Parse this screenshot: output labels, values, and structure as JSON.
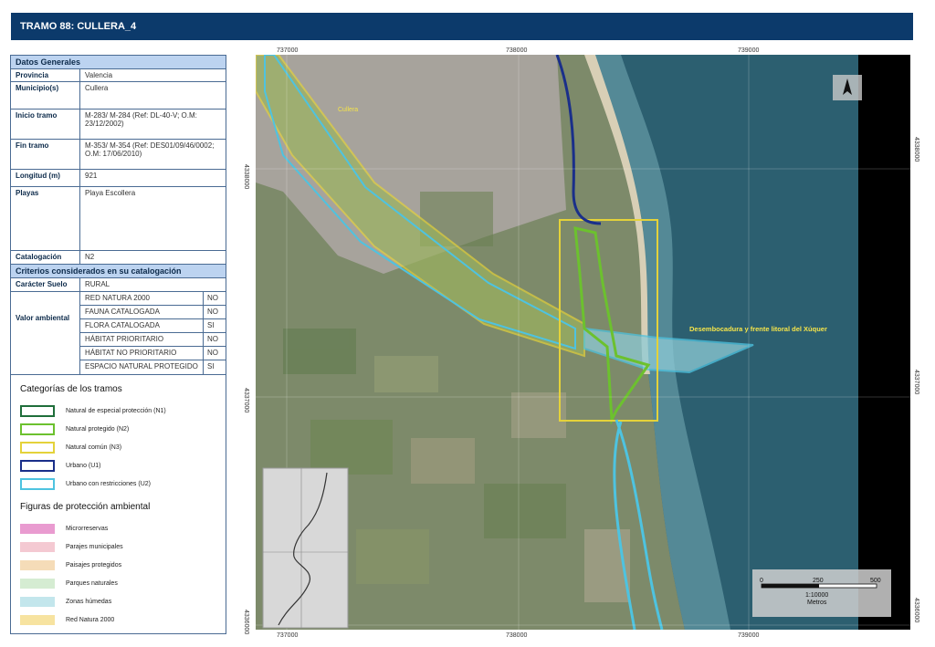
{
  "header": {
    "title": "TRAMO 88: CULLERA_4"
  },
  "datos_generales": {
    "section_title": "Datos Generales",
    "rows": [
      {
        "key": "Provincia",
        "value": "Valencia"
      },
      {
        "key": "Municipio(s)",
        "value": "Cullera"
      },
      {
        "key": "Inicio tramo",
        "value": "M-283/ M-284 (Ref: DL-40-V; O.M: 23/12/2002)"
      },
      {
        "key": "Fin tramo",
        "value": "M-353/ M-354 (Ref: DES01/09/46/0002; O.M: 17/06/2010)"
      },
      {
        "key": "Longitud (m)",
        "value": "921"
      },
      {
        "key": "Playas",
        "value": "Playa Escollera"
      },
      {
        "key": "Catalogación",
        "value": "N2"
      }
    ]
  },
  "criterios": {
    "section_title": "Criterios considerados en su catalogación",
    "caracter_suelo": {
      "key": "Carácter Suelo",
      "value": "RURAL"
    },
    "valor_ambiental": {
      "key": "Valor ambiental",
      "items": [
        {
          "name": "RED NATURA 2000",
          "value": "NO"
        },
        {
          "name": "FAUNA CATALOGADA",
          "value": "NO"
        },
        {
          "name": "FLORA CATALOGADA",
          "value": "SI"
        },
        {
          "name": "HÁBITAT PRIORITARIO",
          "value": "NO"
        },
        {
          "name": "HÁBITAT NO PRIORITARIO",
          "value": "NO"
        },
        {
          "name": "ESPACIO NATURAL PROTEGIDO",
          "value": "SI"
        }
      ]
    }
  },
  "legend": {
    "categorias_title": "Categorías de los tramos",
    "categorias": [
      {
        "label": "Natural de especial protección (N1)",
        "color": "#1f6e3a"
      },
      {
        "label": "Natural protegido (N2)",
        "color": "#6cc12e"
      },
      {
        "label": "Natural común (N3)",
        "color": "#e4d23a"
      },
      {
        "label": "Urbano (U1)",
        "color": "#1a2f8a"
      },
      {
        "label": "Urbano con restricciones (U2)",
        "color": "#4ec3e0"
      }
    ],
    "figuras_title": "Figuras de protección ambiental",
    "figuras": [
      {
        "label": "Microrreservas",
        "color": "#e99bd0"
      },
      {
        "label": "Parajes municipales",
        "color": "#f4c9d2"
      },
      {
        "label": "Paisajes protegidos",
        "color": "#f5dcb8"
      },
      {
        "label": "Parques naturales",
        "color": "#d5ecd2"
      },
      {
        "label": "Zonas húmedas",
        "color": "#c3e6ec"
      },
      {
        "label": "Red Natura 2000",
        "color": "#f7e3a0"
      }
    ]
  },
  "map": {
    "x_ticks": [
      "737000",
      "738000",
      "739000"
    ],
    "y_ticks": [
      "4338000",
      "4337000",
      "4336000"
    ],
    "place_label": "Cullera",
    "feature_label": "Desembocadura y frente litoral del Xúquer",
    "scale": {
      "ticks": [
        "0",
        "250",
        "500"
      ],
      "ratio": "1:10000",
      "unit": "Metros"
    }
  }
}
